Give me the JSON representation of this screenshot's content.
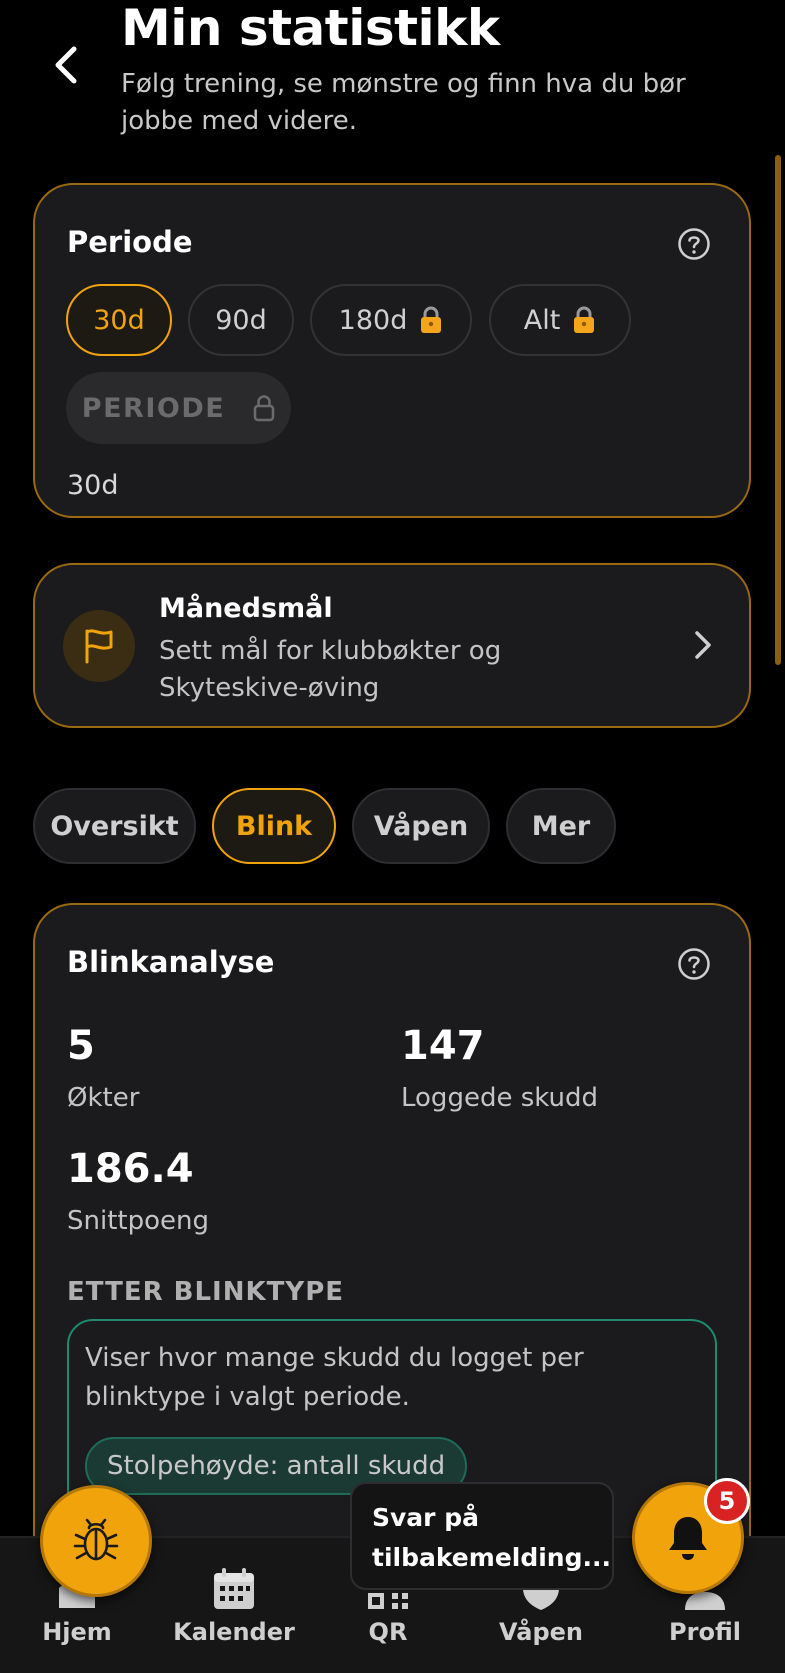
{
  "header": {
    "title": "Min statistikk",
    "subtitle": "Følg trening, se mønstre og finn hva du bør jobbe med videre."
  },
  "period_card": {
    "title": "Periode",
    "pills": [
      {
        "label": "30d",
        "active": true,
        "locked": false
      },
      {
        "label": "90d",
        "active": false,
        "locked": false
      },
      {
        "label": "180d",
        "active": false,
        "locked": true
      },
      {
        "label": "Alt",
        "active": false,
        "locked": true
      }
    ],
    "custom_label": "PERIODE",
    "selected_value": "30d"
  },
  "goal_card": {
    "title": "Månedsmål",
    "description": "Sett mål for klubbøkter og Skyteskive-øving"
  },
  "tabs": [
    {
      "label": "Oversikt",
      "active": false
    },
    {
      "label": "Blink",
      "active": true
    },
    {
      "label": "Våpen",
      "active": false
    },
    {
      "label": "Mer",
      "active": false
    }
  ],
  "blink_card": {
    "title": "Blinkanalyse",
    "stats": [
      {
        "value": "5",
        "label": "Økter"
      },
      {
        "value": "147",
        "label": "Loggede skudd"
      },
      {
        "value": "186.4",
        "label": "Snittpoeng"
      }
    ],
    "section_heading": "ETTER BLINKTYPE",
    "info_text": "Viser hvor mange skudd du logget per blinktype i valgt periode.",
    "chip_label": "Stolpehøyde: antall skudd"
  },
  "bottom_nav": [
    {
      "label": "Hjem",
      "icon": "home-icon"
    },
    {
      "label": "Kalender",
      "icon": "calendar-icon"
    },
    {
      "label": "QR",
      "icon": "qr-icon"
    },
    {
      "label": "Våpen",
      "icon": "shield-icon"
    },
    {
      "label": "Profil",
      "icon": "user-icon"
    }
  ],
  "tooltip": {
    "text": "Svar på tilbakemelding..."
  },
  "notifications": {
    "count": "5"
  },
  "colors": {
    "accent": "#f0a30a",
    "card_bg": "#1b1b1d",
    "card_border": "#9a6a12",
    "teal": "#1f8a6e",
    "badge": "#d92323"
  }
}
